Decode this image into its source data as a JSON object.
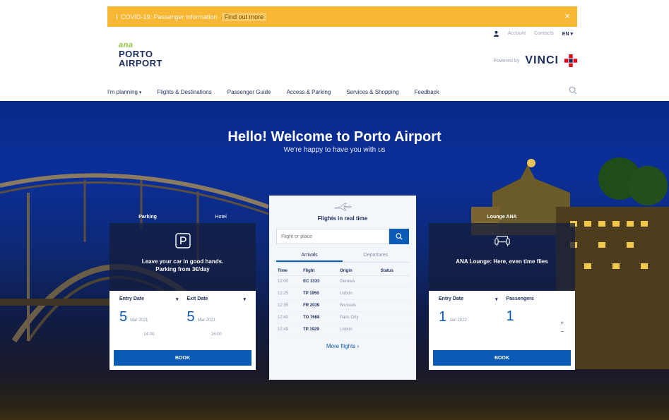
{
  "alert": {
    "message": "COVID-19: Passenger information",
    "link": "Find out more",
    "close": "×"
  },
  "utility": {
    "account": "Account",
    "contacts": "Contacts",
    "language": "EN"
  },
  "logo": {
    "brand": "ana",
    "line1": "PORTO",
    "line2": "AIRPORT"
  },
  "powered": {
    "label": "Powered by",
    "vinci": "VINCI"
  },
  "nav": {
    "items": [
      "I'm planning",
      "Flights & Destinations",
      "Passenger Guide",
      "Access & Parking",
      "Services & Shopping",
      "Feedback"
    ]
  },
  "hero": {
    "title": "Hello! Welcome to Porto Airport",
    "subtitle": "We're happy to have you with us"
  },
  "parking": {
    "tab1": "Parking",
    "tab2": "Hotel",
    "text1": "Leave your car in good hands.",
    "text2": "Parking from 3€/day",
    "entry_label": "Entry Date",
    "exit_label": "Exit Date",
    "entry_day": "5",
    "entry_month": "Mar 2021",
    "exit_day": "5",
    "exit_month": "Mar 2021",
    "entry_time": "14:00",
    "exit_time": "16:00",
    "book": "BOOK"
  },
  "flights": {
    "title": "Flights in real time",
    "search_placeholder": "Flight or place",
    "tab_arrivals": "Arrivals",
    "tab_departures": "Departures",
    "headers": [
      "Time",
      "Flight",
      "Origin",
      "Status"
    ],
    "rows": [
      {
        "time": "12:00",
        "flight": "EC 3333",
        "origin": "Geneva",
        "status": ""
      },
      {
        "time": "12:25",
        "flight": "TP 1950",
        "origin": "Lisbon",
        "status": ""
      },
      {
        "time": "12:35",
        "flight": "FR 2039",
        "origin": "Brussels",
        "status": ""
      },
      {
        "time": "12:40",
        "flight": "TO 7668",
        "origin": "Paris Orly",
        "status": ""
      },
      {
        "time": "12:45",
        "flight": "TP 1929",
        "origin": "Lisbon",
        "status": ""
      }
    ],
    "more": "More flights ›"
  },
  "lounge": {
    "tab": "Lounge ANA",
    "text": "ANA Lounge: Here, even time flies",
    "entry_label": "Entry Date",
    "pax_label": "Passengers",
    "entry_day": "1",
    "entry_month": "Jan 2022",
    "pax_value": "1",
    "plus": "+",
    "minus": "−",
    "book": "BOOK"
  },
  "colors": {
    "alert": "#f7b733",
    "primary": "#0a5bb5",
    "navy": "#1d2d5c",
    "ana_green": "#8cc63f"
  }
}
